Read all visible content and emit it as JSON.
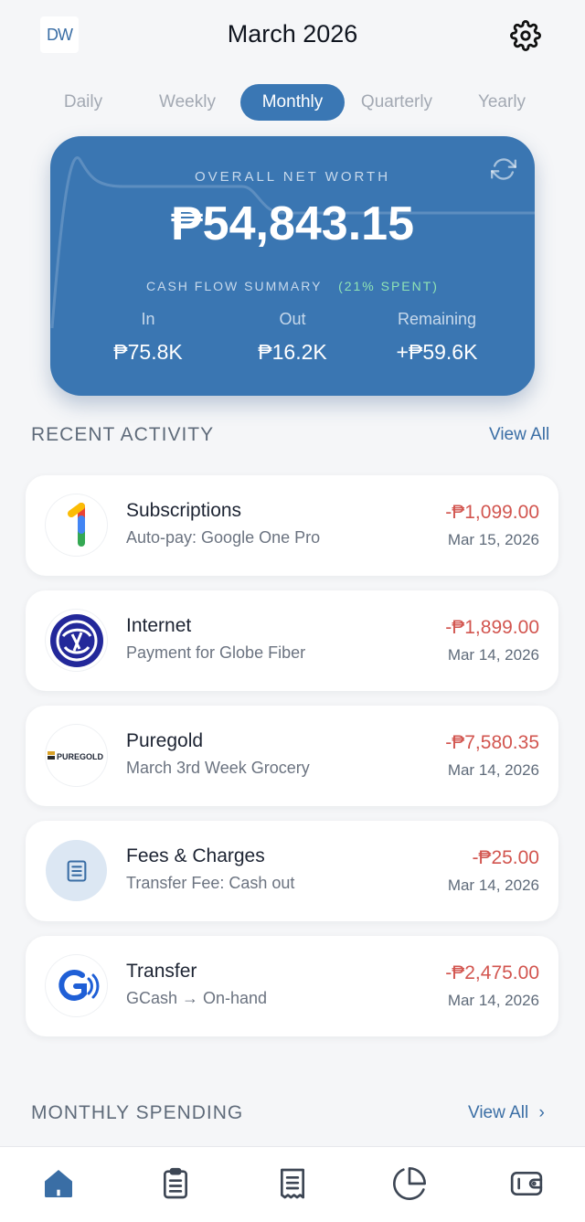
{
  "header": {
    "logo": "DW",
    "title": "March 2026",
    "settings_icon": "gear-icon"
  },
  "periods": [
    {
      "label": "Daily",
      "active": false
    },
    {
      "label": "Weekly",
      "active": false
    },
    {
      "label": "Monthly",
      "active": true
    },
    {
      "label": "Quarterly",
      "active": false
    },
    {
      "label": "Yearly",
      "active": false
    }
  ],
  "networth": {
    "label": "OVERALL NET WORTH",
    "value": "₱54,843.15",
    "cashflow_label": "CASH FLOW SUMMARY",
    "cashflow_pct": "(21% SPENT)",
    "in_label": "In",
    "in_value": "₱75.8K",
    "out_label": "Out",
    "out_value": "₱16.2K",
    "remaining_label": "Remaining",
    "remaining_value": "+₱59.6K",
    "colors": {
      "card": "#3a76b2",
      "spent": "#8fe3b5"
    }
  },
  "recent": {
    "title": "RECENT ACTIVITY",
    "view_all": "View All",
    "items": [
      {
        "title": "Subscriptions",
        "subtitle": "Auto-pay: Google One Pro",
        "amount": "-₱1,099.00",
        "date": "Mar 15, 2026",
        "icon": "google-one-icon"
      },
      {
        "title": "Internet",
        "subtitle": "Payment for Globe Fiber",
        "amount": "-₱1,899.00",
        "date": "Mar 14, 2026",
        "icon": "globe-icon"
      },
      {
        "title": "Puregold",
        "subtitle": "March 3rd Week Grocery",
        "amount": "-₱7,580.35",
        "date": "Mar 14, 2026",
        "icon": "puregold-icon",
        "logo_text": "PUREGOLD"
      },
      {
        "title": "Fees & Charges",
        "subtitle": "Transfer Fee: Cash out",
        "amount": "-₱25.00",
        "date": "Mar 14, 2026",
        "icon": "receipt-icon"
      },
      {
        "title": "Transfer",
        "subtitle": "GCash → On-hand",
        "amount": "-₱2,475.00",
        "date": "Mar 14, 2026",
        "icon": "gcash-icon"
      }
    ]
  },
  "monthly": {
    "title": "MONTHLY SPENDING",
    "view_all": "View All",
    "chevron": "›"
  },
  "nav": [
    "home-icon",
    "clipboard-icon",
    "receipt-icon",
    "pie-chart-icon",
    "wallet-icon"
  ]
}
